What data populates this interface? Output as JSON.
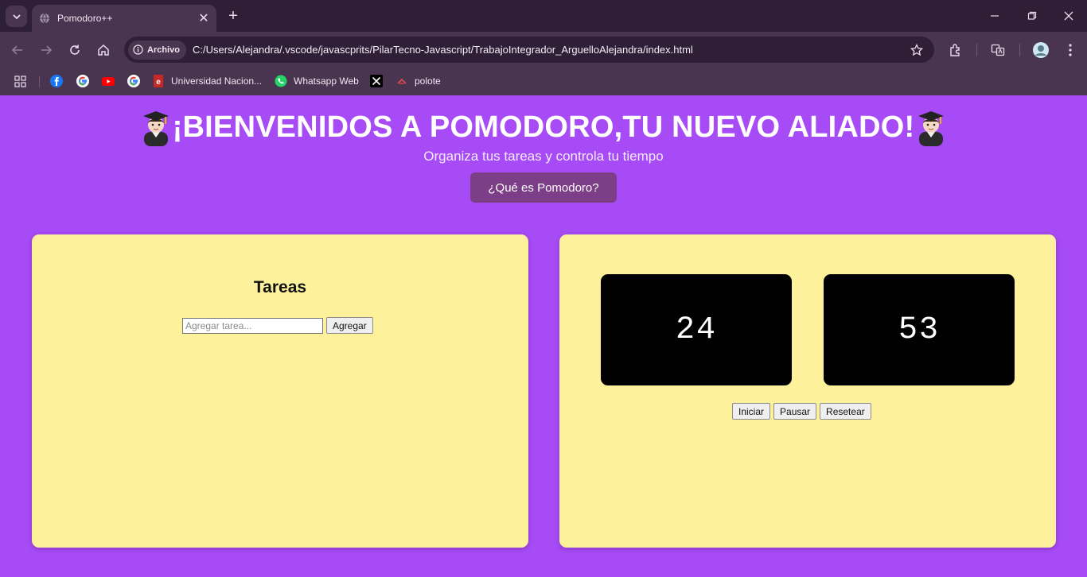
{
  "browser": {
    "tab_title": "Pomodoro++",
    "site_chip": "Archivo",
    "url": "C:/Users/Alejandra/.vscode/javascprits/PilarTecno-Javascript/TrabajoIntegrador_ArguelloAlejandra/index.html",
    "bookmarks": [
      {
        "label": "",
        "icon": "facebook-icon"
      },
      {
        "label": "",
        "icon": "google-icon"
      },
      {
        "label": "",
        "icon": "youtube-icon"
      },
      {
        "label": "",
        "icon": "google-icon"
      },
      {
        "label": "Universidad Nacion...",
        "icon": "university-icon"
      },
      {
        "label": "Whatsapp Web",
        "icon": "whatsapp-icon"
      },
      {
        "label": "",
        "icon": "x-icon"
      },
      {
        "label": "polote",
        "icon": "polote-icon"
      }
    ]
  },
  "hero": {
    "title": "¡BIENVENIDOS A POMODORO,TU NUEVO ALIADO!",
    "subtitle": "Organiza tus tareas y controla tu tiempo",
    "button": "¿Qué es Pomodoro?"
  },
  "tasks": {
    "title": "Tareas",
    "input_placeholder": "Agregar tarea...",
    "input_value": "",
    "add_button": "Agregar"
  },
  "timer": {
    "minutes": "24",
    "seconds": "53",
    "start": "Iniciar",
    "pause": "Pausar",
    "reset": "Resetear"
  },
  "colors": {
    "page_bg": "#a64bf5",
    "card_bg": "#fdf29b",
    "timer_bg": "#000000",
    "button_purple": "#7c3e86"
  }
}
